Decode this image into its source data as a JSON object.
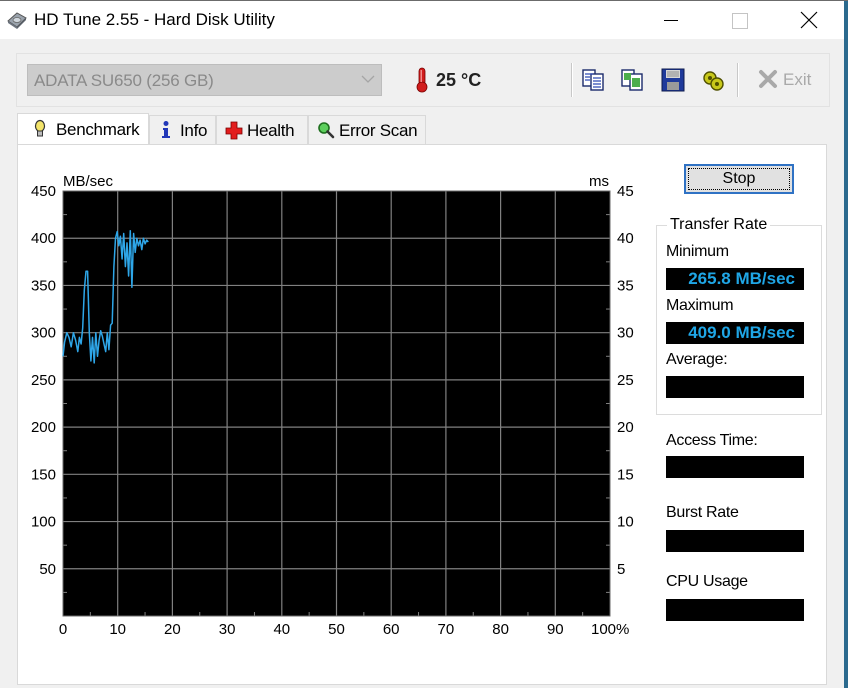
{
  "window": {
    "title": "HD Tune 2.55 - Hard Disk Utility",
    "controls": [
      "minimize",
      "maximize",
      "close"
    ]
  },
  "toolbar": {
    "drive_select": {
      "value": "ADATA   SU650 (256 GB)"
    },
    "temperature": "25 °C",
    "icons": [
      "copy-text-icon",
      "copy-screenshot-icon",
      "save-icon",
      "options-icon"
    ],
    "exit_label": "Exit"
  },
  "tabs": [
    {
      "label": "Benchmark",
      "icon": "lightbulb-icon",
      "active": true
    },
    {
      "label": "Info",
      "icon": "info-icon",
      "active": false
    },
    {
      "label": "Health",
      "icon": "health-cross-icon",
      "active": false
    },
    {
      "label": "Error Scan",
      "icon": "magnifier-icon",
      "active": false
    }
  ],
  "benchmark": {
    "stop_label": "Stop",
    "transfer_rate": {
      "title": "Transfer Rate",
      "minimum_label": "Minimum",
      "minimum_value": "265.8 MB/sec",
      "maximum_label": "Maximum",
      "maximum_value": "409.0 MB/sec",
      "average_label": "Average:",
      "average_value": ""
    },
    "access_time_label": "Access Time:",
    "access_time_value": "",
    "burst_rate_label": "Burst Rate",
    "burst_rate_value": "",
    "cpu_usage_label": "CPU Usage",
    "cpu_usage_value": ""
  },
  "chart_data": {
    "type": "line",
    "title": "",
    "ylabel": "MB/sec",
    "y2label": "ms",
    "xlabel": "",
    "xlim": [
      0,
      100
    ],
    "ylim": [
      0,
      450
    ],
    "y2lim": [
      0,
      45
    ],
    "x_ticks": [
      "0",
      "10",
      "20",
      "30",
      "40",
      "50",
      "60",
      "70",
      "80",
      "90",
      "100%"
    ],
    "y_ticks": [
      "50",
      "100",
      "150",
      "200",
      "250",
      "300",
      "350",
      "400",
      "450"
    ],
    "y2_ticks": [
      "5",
      "10",
      "15",
      "20",
      "25",
      "30",
      "35",
      "40",
      "45"
    ],
    "grid": true,
    "background": "#000000",
    "grid_color": "#808080",
    "line_color": "#2ea6e8",
    "series": [
      {
        "name": "Transfer Rate",
        "x": [
          0,
          0.3,
          0.7,
          1.1,
          1.5,
          1.9,
          2.3,
          2.7,
          3.0,
          3.3,
          3.6,
          3.9,
          4.2,
          4.5,
          4.8,
          5.1,
          5.4,
          5.7,
          6.0,
          6.3,
          6.6,
          6.9,
          7.2,
          7.5,
          7.8,
          8.1,
          8.4,
          8.7,
          9.0,
          9.3,
          9.6,
          9.9,
          10.2,
          10.5,
          10.8,
          11.1,
          11.4,
          11.7,
          12.0,
          12.3,
          12.6,
          12.9,
          13.2,
          13.5,
          13.8,
          14.1,
          14.4,
          14.7,
          15.0,
          15.3,
          15.6
        ],
        "values": [
          275,
          290,
          300,
          295,
          285,
          300,
          292,
          280,
          295,
          288,
          305,
          345,
          365,
          365,
          300,
          270,
          295,
          268,
          300,
          275,
          292,
          302,
          296,
          288,
          280,
          300,
          282,
          308,
          310,
          370,
          400,
          407,
          392,
          402,
          378,
          405,
          370,
          395,
          360,
          408,
          348,
          405,
          385,
          400,
          392,
          398,
          388,
          400,
          394,
          398,
          396
        ]
      }
    ]
  }
}
